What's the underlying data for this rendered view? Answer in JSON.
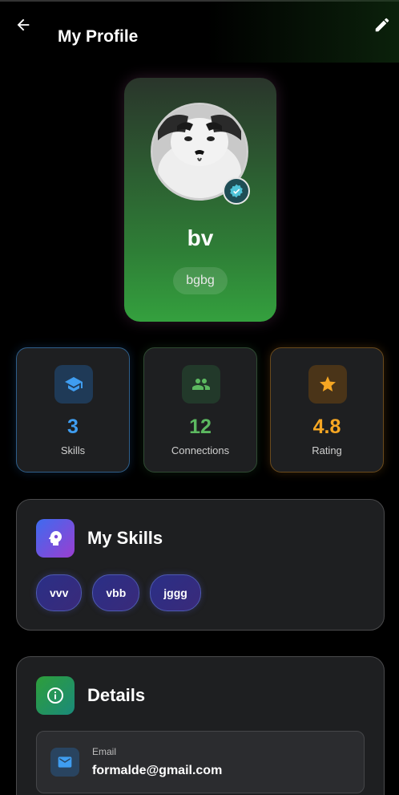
{
  "header": {
    "title": "My Profile",
    "back_icon": "arrow-back-icon",
    "edit_icon": "pencil-icon"
  },
  "profile": {
    "name": "bv",
    "tag": "bgbg",
    "avatar_icon": "avatar-photo",
    "verified_icon": "verified-badge-icon"
  },
  "stats": [
    {
      "value": "3",
      "label": "Skills",
      "icon": "graduation-cap-icon",
      "color": "#3f9df0"
    },
    {
      "value": "12",
      "label": "Connections",
      "icon": "people-icon",
      "color": "#5cb860"
    },
    {
      "value": "4.8",
      "label": "Rating",
      "icon": "star-icon",
      "color": "#f5a623"
    }
  ],
  "skills_section": {
    "title": "My Skills",
    "icon": "brain-gear-icon",
    "chips": [
      "vvv",
      "vbb",
      "jggg"
    ]
  },
  "details_section": {
    "title": "Details",
    "icon": "info-icon",
    "email_label": "Email",
    "email_value": "formalde@gmail.com",
    "email_icon": "mail-icon"
  },
  "colors": {
    "accent_green": "#2e9e3a",
    "accent_blue": "#3f9df0",
    "accent_orange": "#f5a623",
    "background": "#000000",
    "card": "#1e1f21"
  }
}
